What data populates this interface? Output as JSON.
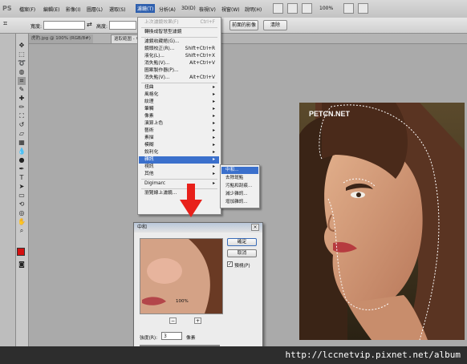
{
  "app": {
    "logo": "PS"
  },
  "menubar": {
    "items": [
      "檔案(F)",
      "編輯(E)",
      "影像(I)",
      "圖層(L)",
      "選取(S)",
      "濾鏡(T)",
      "分析(A)",
      "3D(D)",
      "檢視(V)",
      "視窗(W)",
      "說明(H)"
    ],
    "active_index": 5,
    "zoom": "100%"
  },
  "options": {
    "width_label": "寬度:",
    "height_label": "高度:",
    "front_image_button": "前面的影像",
    "clear_button": "清除"
  },
  "tabs": [
    {
      "label": "虎豹.jpg @ 100% (RGB/8#)"
    },
    {
      "label": "選取範圍 - 中和 …"
    }
  ],
  "filter_menu": {
    "items": [
      {
        "label": "上次濾鏡效果(F)",
        "shortcut": "Ctrl+F",
        "disabled": true
      },
      {
        "sep": true
      },
      {
        "label": "轉換成智慧型濾鏡"
      },
      {
        "sep": true
      },
      {
        "label": "濾鏡收藏館(G)..."
      },
      {
        "label": "鏡頭校正(R)...",
        "shortcut": "Shift+Ctrl+R"
      },
      {
        "label": "液化(L)...",
        "shortcut": "Shift+Ctrl+X"
      },
      {
        "label": "消失點(V)...",
        "shortcut": "Alt+Ctrl+V"
      },
      {
        "label": "圖案製作器(P)..."
      },
      {
        "label": "消失點(V)...",
        "shortcut": "Alt+Ctrl+V"
      },
      {
        "sep": true
      },
      {
        "label": "扭曲",
        "sub": true
      },
      {
        "label": "風格化",
        "sub": true
      },
      {
        "label": "紋理",
        "sub": true
      },
      {
        "label": "筆觸",
        "sub": true
      },
      {
        "label": "像素",
        "sub": true
      },
      {
        "label": "演算上色",
        "sub": true
      },
      {
        "label": "藝術",
        "sub": true
      },
      {
        "label": "素描",
        "sub": true
      },
      {
        "label": "模糊",
        "sub": true
      },
      {
        "label": "銳利化",
        "sub": true
      },
      {
        "label": "雜訊",
        "sub": true,
        "highlight": true
      },
      {
        "label": "視訊",
        "sub": true
      },
      {
        "label": "其他",
        "sub": true
      },
      {
        "sep": true
      },
      {
        "label": "Digimarc",
        "sub": true
      },
      {
        "sep": true
      },
      {
        "label": "瀏覽線上濾鏡..."
      }
    ]
  },
  "noise_submenu": {
    "items": [
      {
        "label": "中和...",
        "highlight": true
      },
      {
        "label": "去除斑點"
      },
      {
        "label": "污點和刮痕..."
      },
      {
        "label": "減少雜訊..."
      },
      {
        "label": "增加雜訊..."
      }
    ]
  },
  "dialog": {
    "title": "中和",
    "ok": "確定",
    "cancel": "取消",
    "preview_label": "預視(P)",
    "preview_checked": true,
    "zoom_minus": "−",
    "zoom_plus": "+",
    "zoom_value": "100%",
    "radius_label": "強度(R):",
    "radius_value": "3",
    "unit": "像素"
  },
  "photo": {
    "watermark": "PETCN.NET"
  },
  "footer": {
    "url": "http://lccnetvip.pixnet.net/album"
  },
  "colors": {
    "accent": "#3b70cc",
    "arrow": "#e8201a",
    "foreground": "#d41010",
    "background": "#ffffff"
  }
}
